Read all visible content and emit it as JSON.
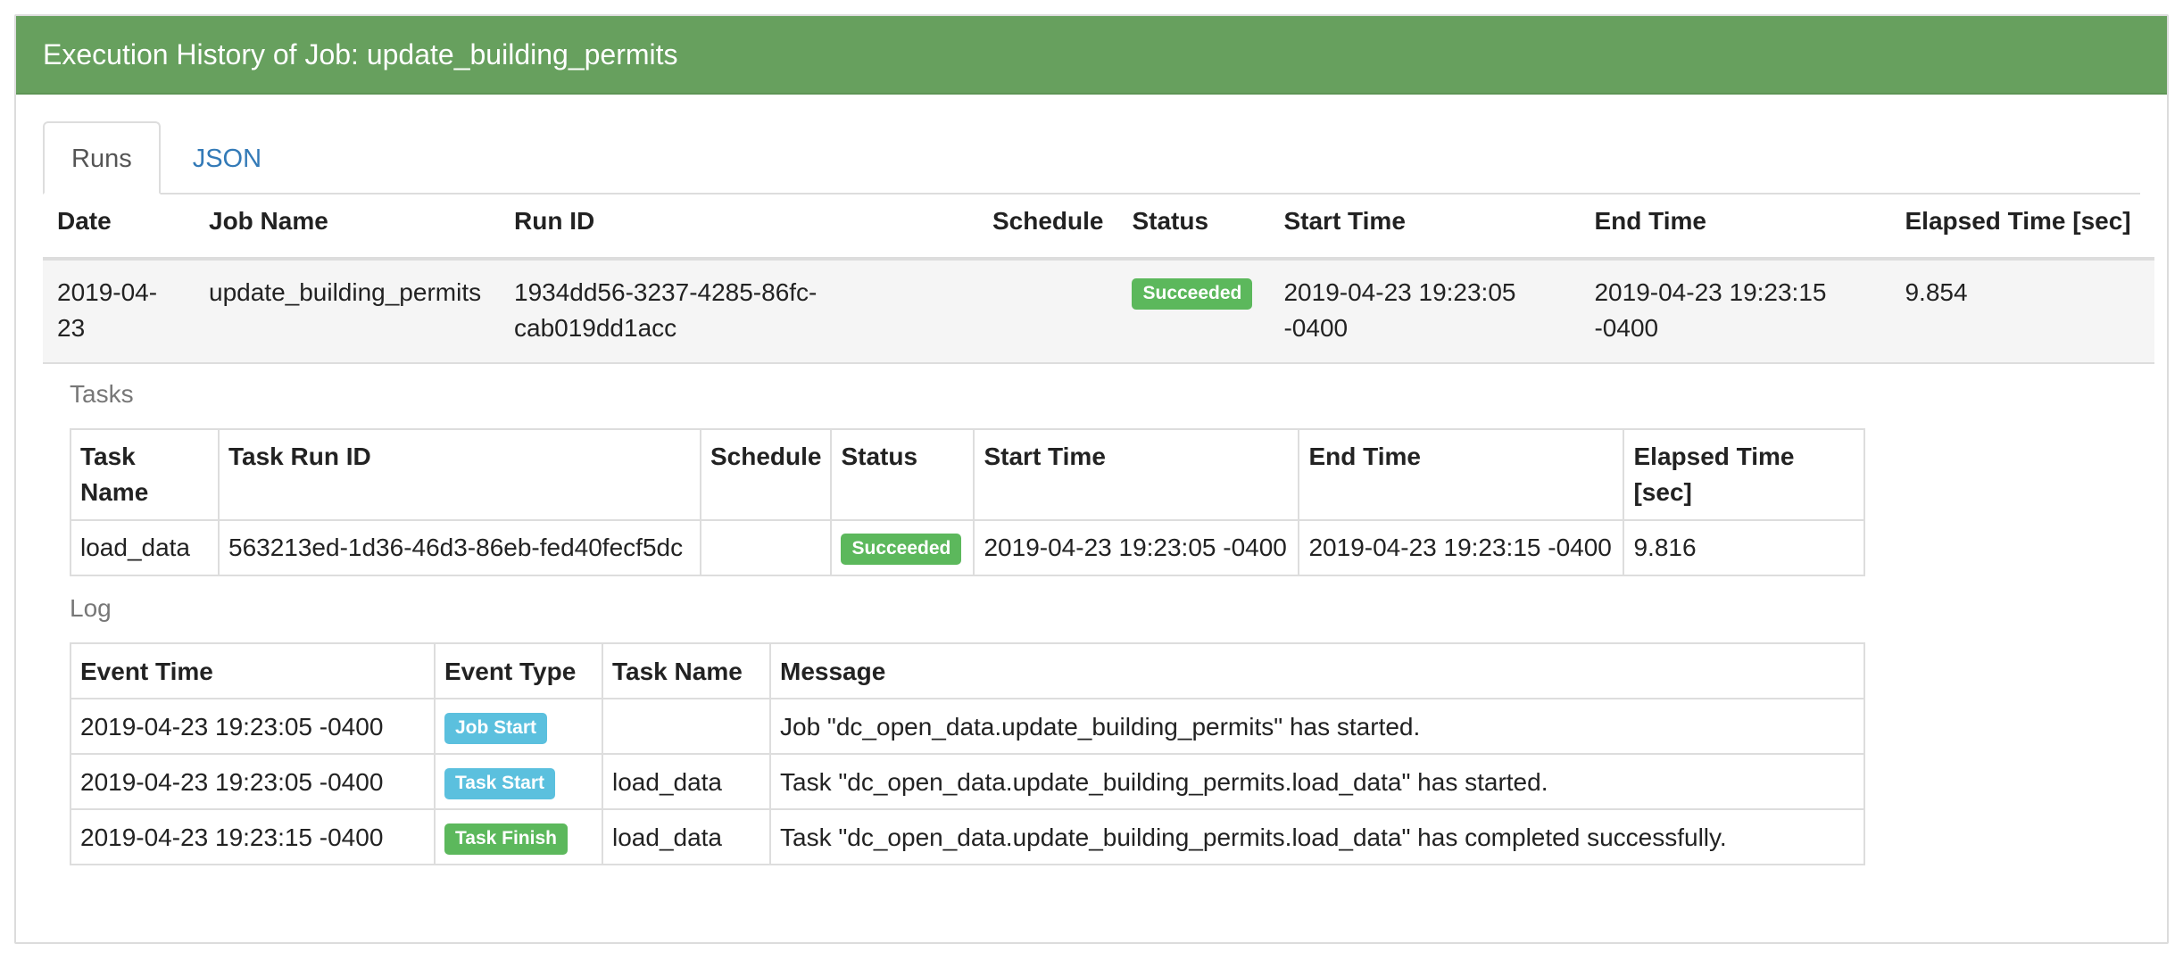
{
  "panel": {
    "title": "Execution History of Job: update_building_permits"
  },
  "tabs": [
    {
      "label": "Runs"
    },
    {
      "label": "JSON"
    }
  ],
  "runs": {
    "headers": [
      "Date",
      "Job Name",
      "Run ID",
      "Schedule",
      "Status",
      "Start Time",
      "End Time",
      "Elapsed Time [sec]"
    ],
    "rows": [
      {
        "date": "2019-04-23",
        "job_name": "update_building_permits",
        "run_id": "1934dd56-3237-4285-86fc-cab019dd1acc",
        "schedule": "",
        "status": "Succeeded",
        "start_time": "2019-04-23 19:23:05 -0400",
        "end_time": "2019-04-23 19:23:15 -0400",
        "elapsed": "9.854"
      }
    ]
  },
  "tasks": {
    "title": "Tasks",
    "headers": [
      "Task Name",
      "Task Run ID",
      "Schedule",
      "Status",
      "Start Time",
      "End Time",
      "Elapsed Time [sec]"
    ],
    "rows": [
      {
        "task_name": "load_data",
        "task_run_id": "563213ed-1d36-46d3-86eb-fed40fecf5dc",
        "schedule": "",
        "status": "Succeeded",
        "start_time": "2019-04-23 19:23:05 -0400",
        "end_time": "2019-04-23 19:23:15 -0400",
        "elapsed": "9.816"
      }
    ]
  },
  "log": {
    "title": "Log",
    "headers": [
      "Event Time",
      "Event Type",
      "Task Name",
      "Message"
    ],
    "rows": [
      {
        "event_time": "2019-04-23 19:23:05 -0400",
        "event_type": "Job Start",
        "event_color": "#5bc0de",
        "task_name": "",
        "message": "Job \"dc_open_data.update_building_permits\" has started."
      },
      {
        "event_time": "2019-04-23 19:23:05 -0400",
        "event_type": "Task Start",
        "event_color": "#5bc0de",
        "task_name": "load_data",
        "message": "Task \"dc_open_data.update_building_permits.load_data\" has started."
      },
      {
        "event_time": "2019-04-23 19:23:15 -0400",
        "event_type": "Task Finish",
        "event_color": "#5cb85c",
        "task_name": "load_data",
        "message": "Task \"dc_open_data.update_building_permits.load_data\" has completed successfully."
      }
    ]
  },
  "colors": {
    "header_green": "#67a05e",
    "success": "#5cb85c",
    "info": "#5bc0de",
    "link": "#337ab7"
  }
}
